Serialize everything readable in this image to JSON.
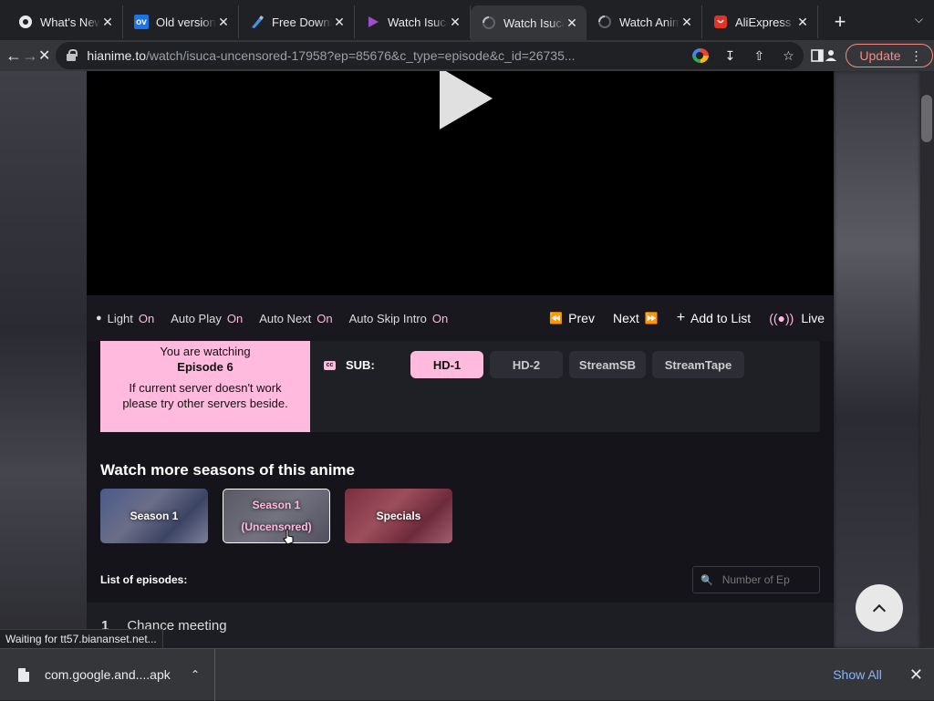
{
  "tabs": [
    {
      "title": "What's New",
      "favicon": "chrome-icon",
      "close": "✕"
    },
    {
      "title": "Old versions",
      "favicon": "ov-icon",
      "favicon_text": "ov",
      "close": "✕"
    },
    {
      "title": "Free Download",
      "favicon": "pen-icon",
      "close": "✕"
    },
    {
      "title": "Watch Isuca",
      "favicon": "play-icon",
      "close": "✕"
    },
    {
      "title": "Watch Isuca",
      "favicon": "loading-icon",
      "close": "✕",
      "active": true
    },
    {
      "title": "Watch Anime",
      "favicon": "loading-icon",
      "close": "✕"
    },
    {
      "title": "AliExpress",
      "favicon": "aliexpress-icon",
      "close": "✕"
    }
  ],
  "toolbar": {
    "url_domain": "hianime.to",
    "url_path": "/watch/isuca-uncensored-17958?ep=85676&c_type=episode&c_id=26735...",
    "update_label": "Update"
  },
  "controls": {
    "light_label": "Light",
    "light_state": "On",
    "autoplay_label": "Auto Play",
    "autoplay_state": "On",
    "autonext_label": "Auto Next",
    "autonext_state": "On",
    "autoskip_label": "Auto Skip Intro",
    "autoskip_state": "On",
    "prev_label": "Prev",
    "next_label": "Next",
    "add_label": "Add to List",
    "live_label": "Live"
  },
  "watching": {
    "line1": "You are watching",
    "episode": "Episode 6",
    "note": "If current server doesn't work please try other servers beside."
  },
  "servers": {
    "sub_label": "SUB:",
    "items": [
      "HD-1",
      "HD-2",
      "StreamSB",
      "StreamTape"
    ],
    "active": "HD-1"
  },
  "seasons": {
    "title": "Watch more seasons of this anime",
    "items": [
      "Season 1",
      "Season 1 (Uncensored)",
      "Specials"
    ]
  },
  "episodes": {
    "label": "List of episodes:",
    "search_placeholder": "Number of Ep",
    "rows": [
      {
        "number": "1",
        "title": "Chance meeting"
      }
    ]
  },
  "status_text": "Waiting for tt57.biananset.net...",
  "downloads": {
    "file": "com.google.and....apk",
    "show_all": "Show All"
  },
  "colors": {
    "accent": "#ffbade",
    "chrome_bg": "#202124",
    "chrome_toolbar": "#35363a",
    "link": "#8ab4f8"
  }
}
